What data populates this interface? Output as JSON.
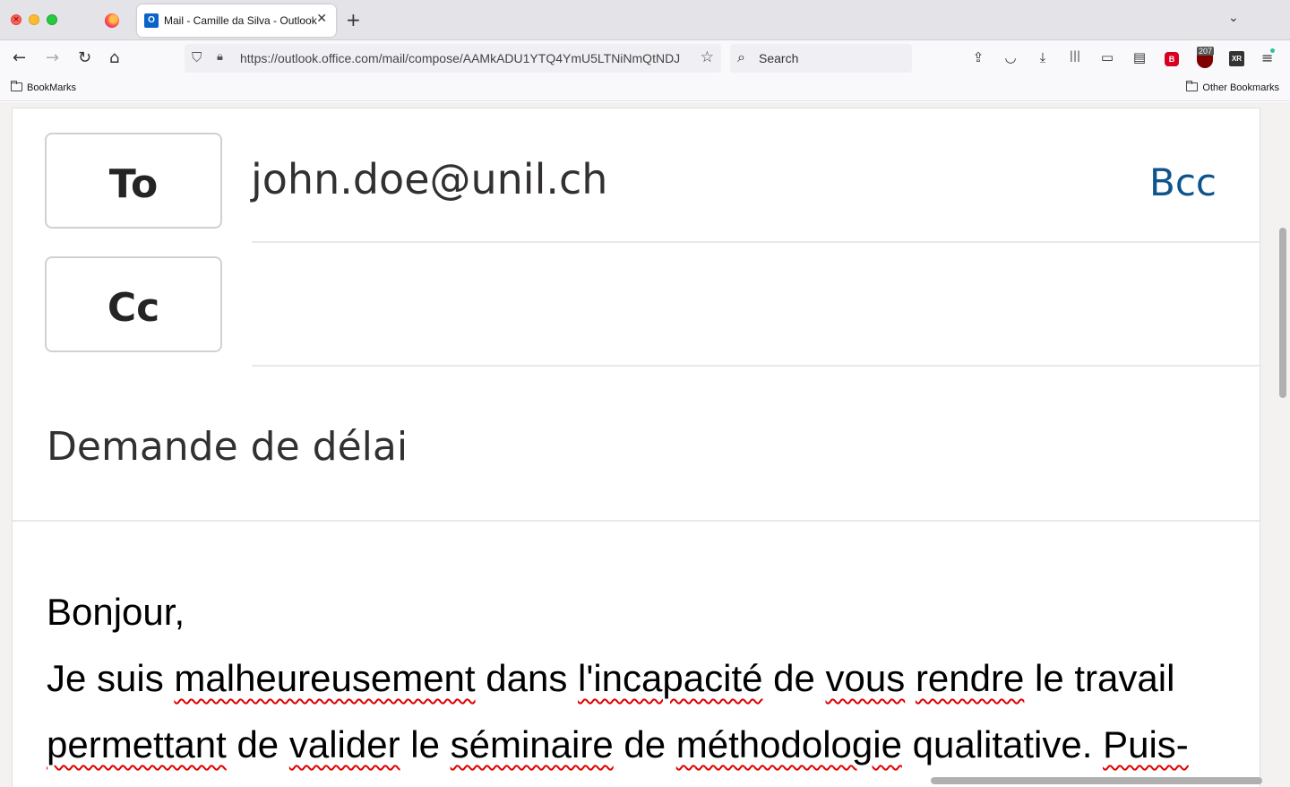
{
  "browser": {
    "tab": {
      "favicon": "O",
      "title": "Mail - Camille da Silva - Outlook"
    },
    "url": "https://outlook.office.com/mail/compose/AAMkADU1YTQ4YmU5LTNiNmQtNDJ",
    "search_placeholder": "Search",
    "extension_badge": "207",
    "extension_red_label": "B",
    "extension_xr_label": "XR",
    "bookmarks": {
      "left": "BookMarks",
      "right": "Other Bookmarks"
    },
    "icons": {
      "back": "←",
      "forward": "→",
      "reload": "↻",
      "home": "⌂",
      "shield": "⛉",
      "lock": "🔒︎",
      "star": "☆",
      "search": "⌕",
      "tab_close": "✕",
      "new_tab": "+",
      "tab_list": "⌄",
      "share": "⇪",
      "pocket": "◡",
      "download": "⤓",
      "library": "|||",
      "sidebar": "▭",
      "reader": "▤",
      "menu": "≡"
    }
  },
  "compose": {
    "to_label": "To",
    "to_value": "john.doe@unil.ch",
    "bcc_label": "Bcc",
    "cc_label": "Cc",
    "subject": "Demande de délai",
    "body": {
      "greeting": "Bonjour,",
      "line1": [
        "Je suis ",
        "malheureusement",
        " dans ",
        "l'incapacité",
        " de ",
        "vous",
        " ",
        "rendre",
        " le travail"
      ],
      "line2": [
        "permettant",
        " de ",
        "valider",
        " le ",
        "séminaire",
        " de ",
        "méthodologie",
        " qualitative. ",
        "Puis-"
      ]
    }
  },
  "colors": {
    "accent": "#0f548c",
    "spellcheck": "#e00000"
  }
}
